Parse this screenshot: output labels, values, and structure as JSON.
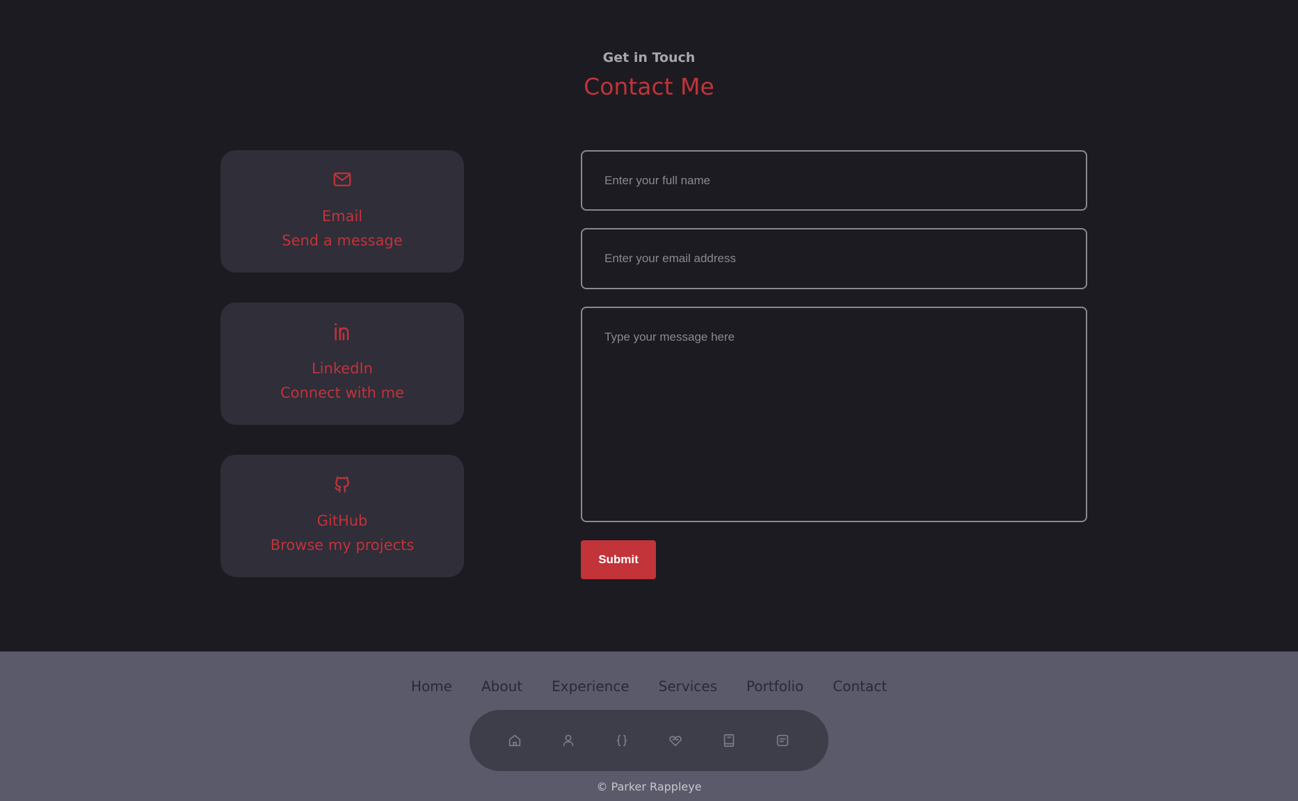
{
  "header": {
    "subtitle": "Get in Touch",
    "title": "Contact Me"
  },
  "contact_cards": [
    {
      "icon": "mail-icon",
      "title": "Email",
      "subtitle": "Send a message"
    },
    {
      "icon": "linkedin-icon",
      "title": "LinkedIn",
      "subtitle": "Connect with me"
    },
    {
      "icon": "github-icon",
      "title": "GitHub",
      "subtitle": "Browse my projects"
    }
  ],
  "form": {
    "name_placeholder": "Enter your full name",
    "email_placeholder": "Enter your email address",
    "message_placeholder": "Type your message here",
    "submit_label": "Submit"
  },
  "footer": {
    "links": [
      "Home",
      "About",
      "Experience",
      "Services",
      "Portfolio",
      "Contact"
    ],
    "dock_icons": [
      "home-icon",
      "user-icon",
      "code-braces-icon",
      "handshake-icon",
      "book-icon",
      "message-icon"
    ],
    "copyright": "© Parker Rappleye"
  },
  "colors": {
    "background": "#1c1b21",
    "card": "#2f2e39",
    "accent": "#c2333a",
    "footer": "#5b5a6b",
    "dock": "#3e3d4a"
  }
}
